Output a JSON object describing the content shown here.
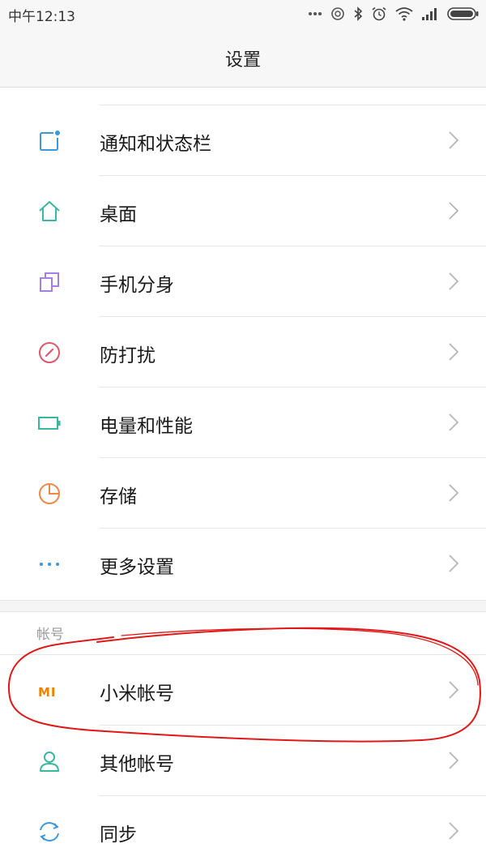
{
  "status_bar": {
    "time": "中午12:13",
    "icons": [
      "more-dots-icon",
      "sync-cloud-icon",
      "bluetooth-icon",
      "alarm-icon",
      "wifi-icon",
      "signal-icon",
      "battery-icon"
    ]
  },
  "header": {
    "title": "设置"
  },
  "settings": [
    {
      "label": "通知和状态栏",
      "icon": "notification-icon",
      "color": "#3a9ad9"
    },
    {
      "label": "桌面",
      "icon": "home-icon",
      "color": "#3ab7a0"
    },
    {
      "label": "手机分身",
      "icon": "dual-app-icon",
      "color": "#a67ee6"
    },
    {
      "label": "防打扰",
      "icon": "do-not-disturb-icon",
      "color": "#e0566b"
    },
    {
      "label": "电量和性能",
      "icon": "battery-performance-icon",
      "color": "#3ab7a0"
    },
    {
      "label": "存储",
      "icon": "storage-icon",
      "color": "#f0884c"
    },
    {
      "label": "更多设置",
      "icon": "more-settings-icon",
      "color": "#3a9ad9"
    }
  ],
  "accounts": {
    "header": "帐号",
    "items": [
      {
        "label": "小米帐号",
        "icon": "mi-account-icon",
        "logo_text": "MI",
        "color": "#f08200"
      },
      {
        "label": "其他帐号",
        "icon": "user-icon",
        "color": "#3ab7a0"
      },
      {
        "label": "同步",
        "icon": "sync-icon",
        "color": "#3a9ad9"
      }
    ]
  },
  "annotation": {
    "type": "hand-drawn-circle",
    "target": "小米帐号",
    "color": "#e01818"
  }
}
